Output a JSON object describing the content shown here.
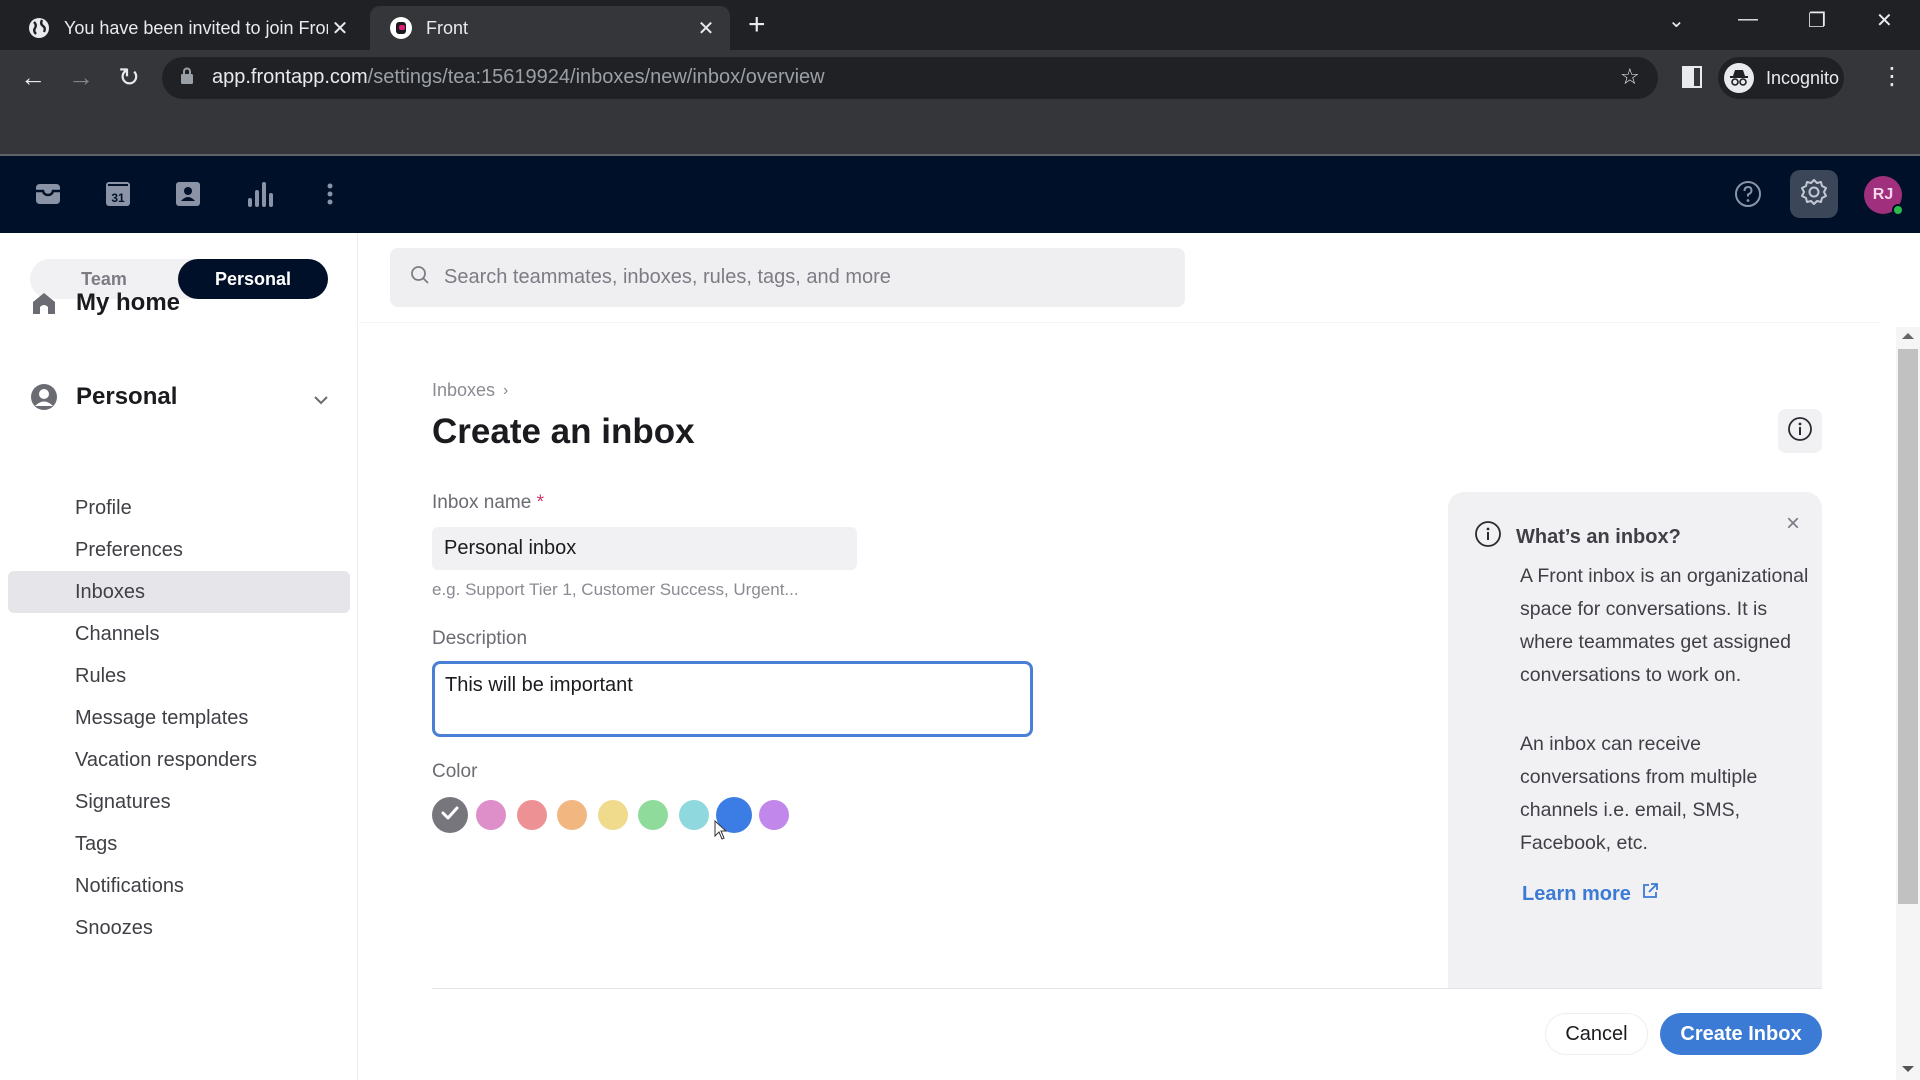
{
  "browser": {
    "tabs": [
      {
        "title": "You have been invited to join Front",
        "icon": "globe-icon",
        "active": false
      },
      {
        "title": "Front",
        "icon": "front-logo-icon",
        "active": true
      }
    ],
    "url_host": "app.frontapp.com",
    "url_path": "/settings/tea:15619924/inboxes/new/inbox/overview",
    "profile_label": "Incognito"
  },
  "app_header": {
    "nav_icons": [
      "inbox-icon",
      "calendar-icon",
      "contacts-icon",
      "analytics-icon",
      "more-icon"
    ],
    "calendar_day": "31",
    "avatar_initials": "RJ",
    "avatar_color": "#a0307d",
    "status": "online"
  },
  "sidebar": {
    "toggle": {
      "options": [
        "Team",
        "Personal"
      ],
      "selected": "Personal"
    },
    "home_label": "My home",
    "section_label": "Personal",
    "items": [
      {
        "label": "Profile"
      },
      {
        "label": "Preferences"
      },
      {
        "label": "Inboxes",
        "active": true
      },
      {
        "label": "Channels"
      },
      {
        "label": "Rules"
      },
      {
        "label": "Message templates"
      },
      {
        "label": "Vacation responders"
      },
      {
        "label": "Signatures"
      },
      {
        "label": "Tags"
      },
      {
        "label": "Notifications"
      },
      {
        "label": "Snoozes"
      }
    ]
  },
  "search": {
    "placeholder": "Search teammates, inboxes, rules, tags, and more",
    "value": ""
  },
  "main": {
    "breadcrumb": "Inboxes",
    "title": "Create an inbox",
    "name_label": "Inbox name",
    "required_mark": "*",
    "name_value": "Personal inbox",
    "name_hint": "e.g. Support Tier 1, Customer Success, Urgent...",
    "description_label": "Description",
    "description_value": "This will be important",
    "color_label": "Color",
    "colors": [
      {
        "hex": "#76767c",
        "selected": true
      },
      {
        "hex": "#de8ec8",
        "selected": false
      },
      {
        "hex": "#ee9195",
        "selected": false
      },
      {
        "hex": "#f2b780",
        "selected": false
      },
      {
        "hex": "#f0da8c",
        "selected": false
      },
      {
        "hex": "#8fdb9c",
        "selected": false
      },
      {
        "hex": "#8fd8de",
        "selected": false
      },
      {
        "hex": "#3b7de4",
        "selected": false,
        "hovered": true
      },
      {
        "hex": "#c287ea",
        "selected": false
      }
    ],
    "cancel_label": "Cancel",
    "create_label": "Create Inbox"
  },
  "info_panel": {
    "title": "What’s an inbox?",
    "paragraph1": "A Front inbox is an organizational space for conversations. It is where teammates get assigned conversations to work on.",
    "paragraph2": "An inbox can receive conversations from multiple channels i.e. email, SMS, Facebook, etc.",
    "link_label": "Learn more"
  },
  "accent_color": "#3b7bd6"
}
